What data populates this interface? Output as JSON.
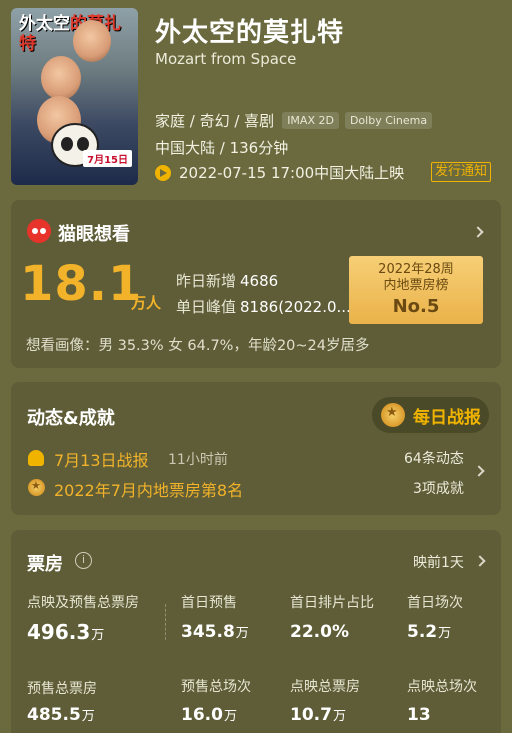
{
  "movie": {
    "title": "外太空的莫扎特",
    "subtitle": "Mozart from Space",
    "genres": "家庭 / 奇幻 / 喜剧",
    "tags": [
      "IMAX 2D",
      "Dolby Cinema"
    ],
    "country_duration": "中国大陆 / 136分钟",
    "release": "2022-07-15 17:00中国大陆上映",
    "notify_label": "发行通知",
    "poster": {
      "title_a": "外太空",
      "title_b": "的莫扎特",
      "date_badge": "7月15日"
    }
  },
  "want_to_see": {
    "header": "猫眼想看",
    "value": "18.1",
    "unit": "万人",
    "yesterday_label": "昨日新增",
    "yesterday_value": "4686",
    "peak_label": "单日峰值",
    "peak_value": "8186(2022.0...",
    "rank_line1": "2022年28周",
    "rank_line2": "内地票房榜",
    "rank_value": "No.5",
    "portrait": "想看画像：男 35.3%  女 64.7%，年龄20~24岁居多"
  },
  "news": {
    "header": "动态&成就",
    "daily_report_label": "每日战报",
    "item1_text": "7月13日战报",
    "item1_time": "11小时前",
    "item2_text": "2022年7月内地票房第8名",
    "dynamics_count": "64条动态",
    "achievements_count": "3项成就"
  },
  "box_office": {
    "header": "票房",
    "info_icon": "i",
    "presale_days": "映前1天",
    "stats": [
      {
        "label": "点映及预售总票房",
        "value": "496.3",
        "unit": "万"
      },
      {
        "label": "首日预售",
        "value": "345.8",
        "unit": "万"
      },
      {
        "label": "首日排片占比",
        "value": "22.0%",
        "unit": ""
      },
      {
        "label": "首日场次",
        "value": "5.2",
        "unit": "万"
      },
      {
        "label": "预售总票房",
        "value": "485.5",
        "unit": "万"
      },
      {
        "label": "预售总场次",
        "value": "16.0",
        "unit": "万"
      },
      {
        "label": "点映总票房",
        "value": "10.7",
        "unit": "万"
      },
      {
        "label": "点映总场次",
        "value": "13",
        "unit": ""
      }
    ]
  },
  "colors": {
    "background": "#6b6a3f",
    "card": "#5e5d37",
    "accent_gold": "#f2b32a",
    "maoyan_red": "#e8332a"
  }
}
